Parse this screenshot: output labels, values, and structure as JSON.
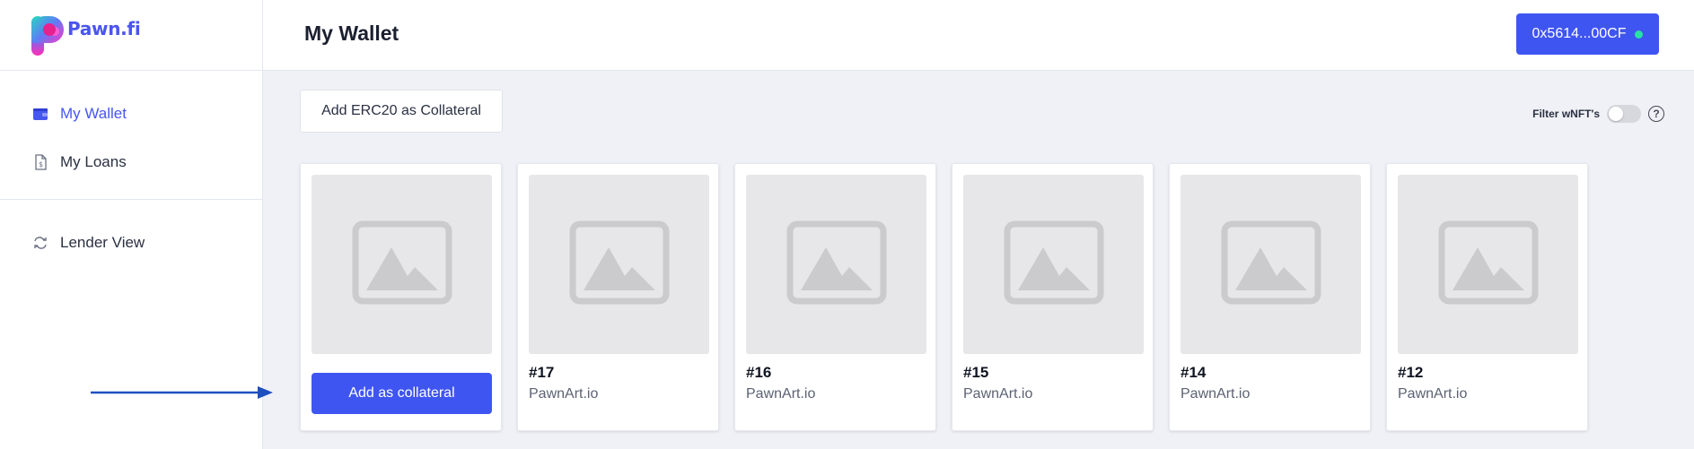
{
  "app": {
    "logo_text": "Pawn.fi"
  },
  "sidebar": {
    "items": [
      {
        "label": "My Wallet",
        "icon": "wallet-icon",
        "active": true
      },
      {
        "label": "My Loans",
        "icon": "invoice-icon",
        "active": false
      },
      {
        "label": "Lender View",
        "icon": "exchange-icon",
        "active": false
      }
    ]
  },
  "header": {
    "title": "My Wallet",
    "wallet_address": "0x5614...00CF",
    "wallet_status_color": "#27e3a0"
  },
  "toolbar": {
    "add_erc20_label": "Add ERC20 as Collateral",
    "filter_label": "Filter wNFT's",
    "filter_enabled": false,
    "help_label": "?"
  },
  "cards": [
    {
      "type": "action",
      "button_label": "Add as collateral"
    },
    {
      "type": "nft",
      "id": "#17",
      "source": "PawnArt.io"
    },
    {
      "type": "nft",
      "id": "#16",
      "source": "PawnArt.io"
    },
    {
      "type": "nft",
      "id": "#15",
      "source": "PawnArt.io"
    },
    {
      "type": "nft",
      "id": "#14",
      "source": "PawnArt.io"
    },
    {
      "type": "nft",
      "id": "#12",
      "source": "PawnArt.io"
    }
  ],
  "colors": {
    "accent": "#3f55f1",
    "active_nav": "#4656f0",
    "background": "#f0f1f6",
    "arrow": "#1d4fbf"
  }
}
